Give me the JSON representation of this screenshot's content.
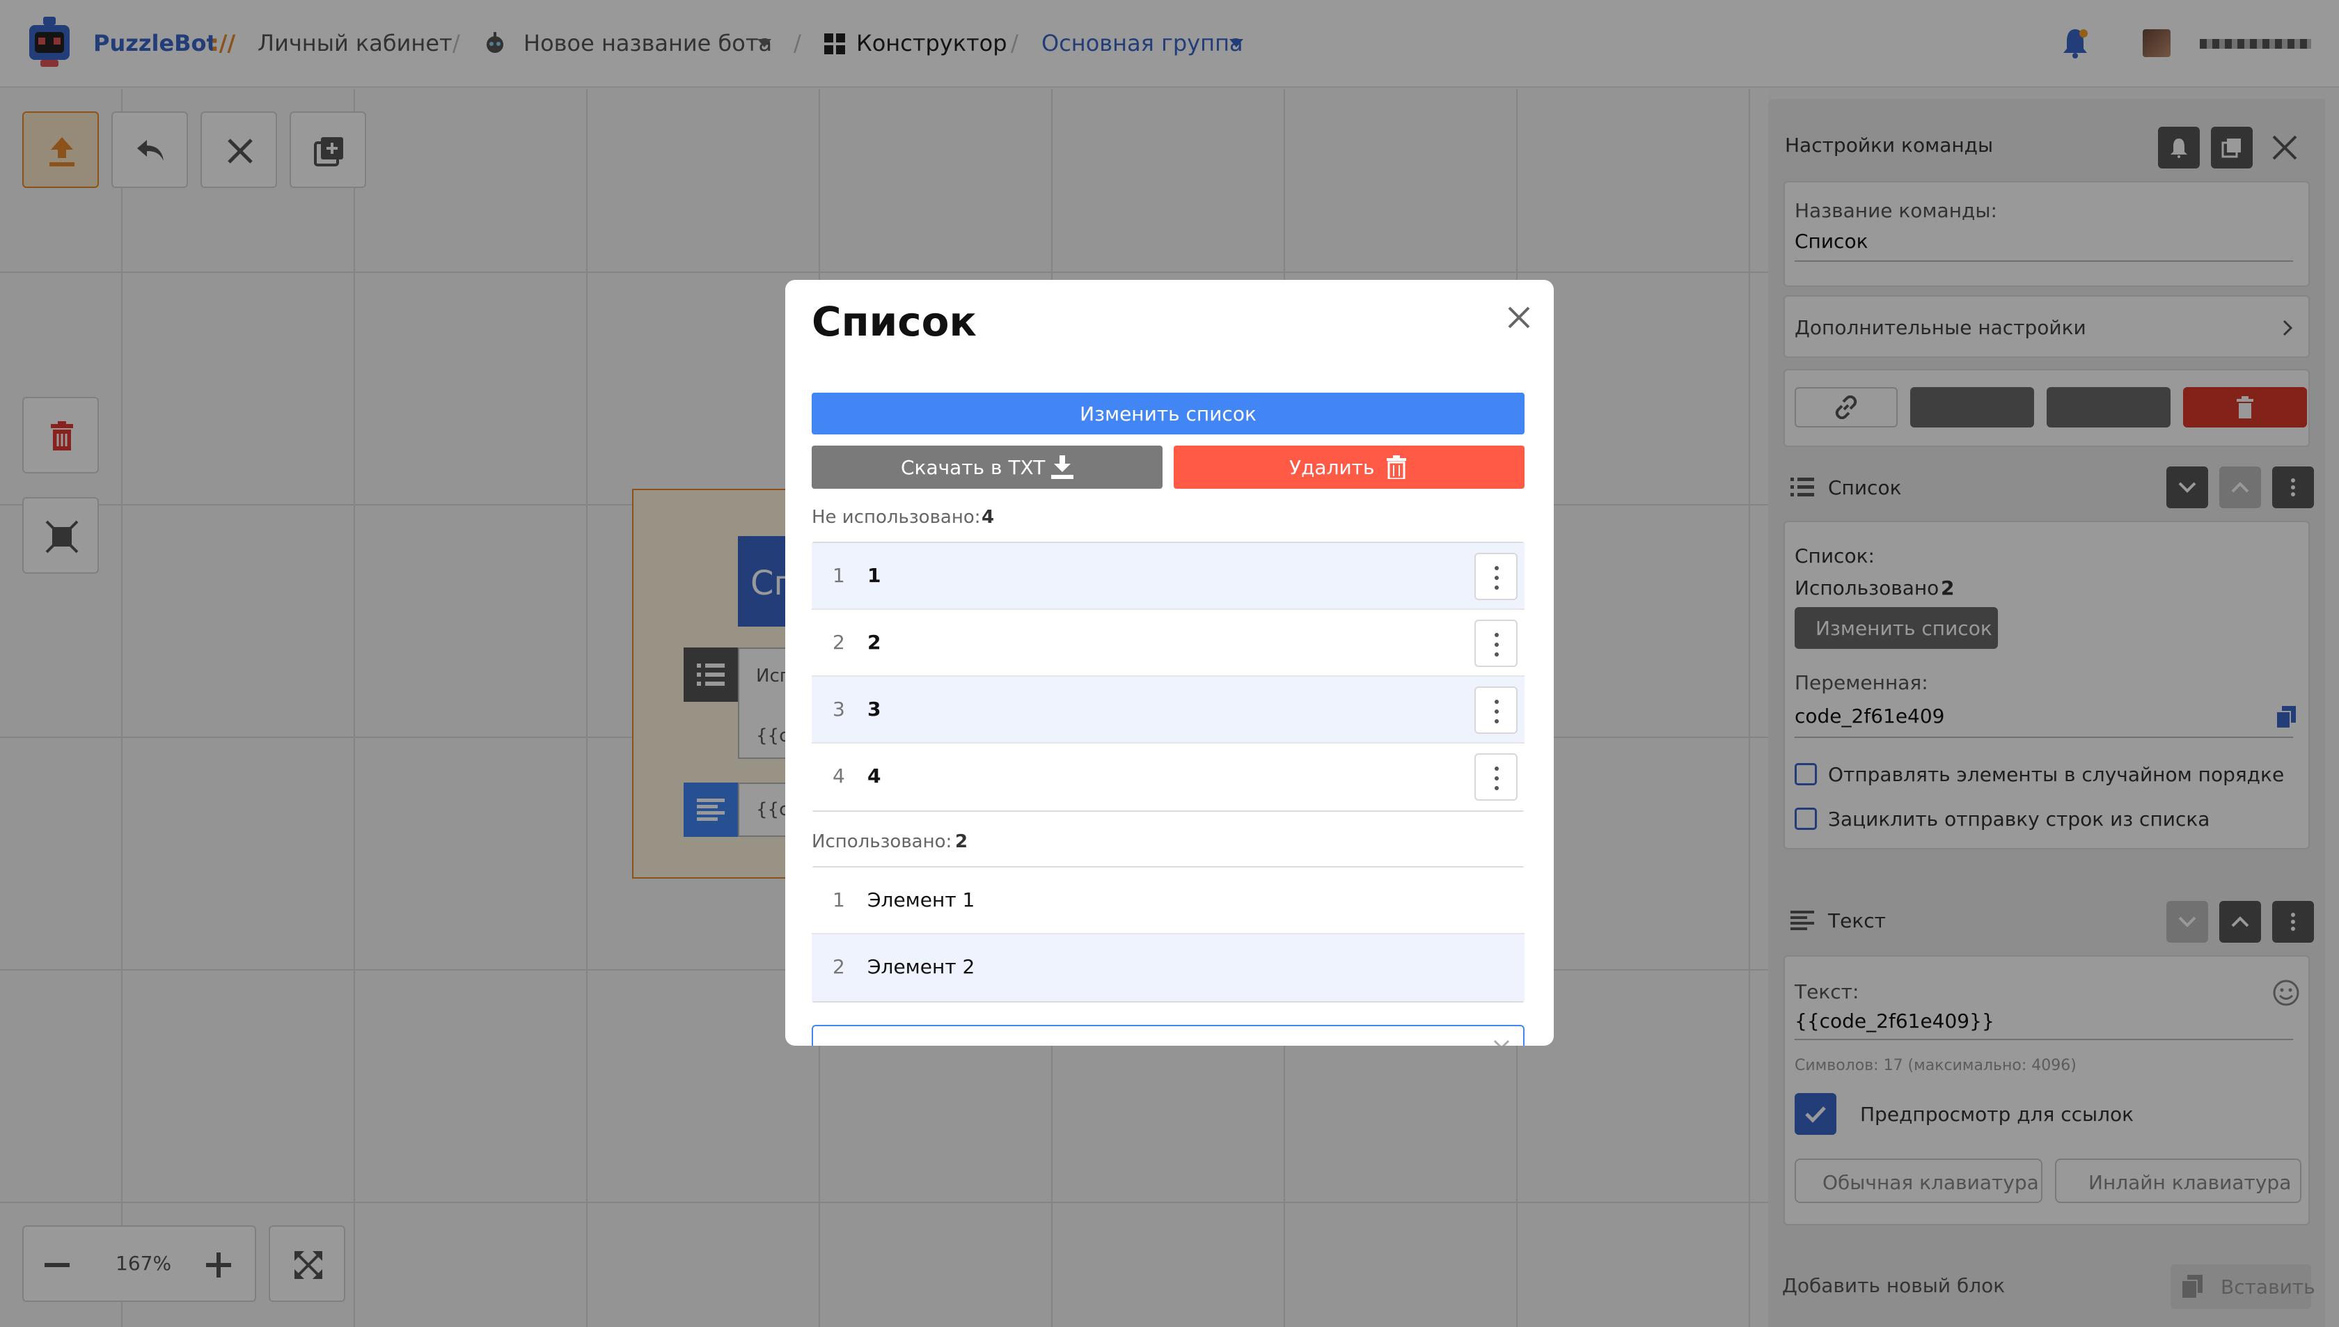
{
  "topbar": {
    "brand": "PuzzleBot",
    "brand_sep": "://",
    "cabinet": "Личный кабинет",
    "bot_name": "Новое название бота",
    "constructor": "Конструктор",
    "group": "Основная группа",
    "separator": "/"
  },
  "canvas": {
    "zoom": "167%",
    "node_title_partial": "Сп",
    "node_list_partial": "Исп",
    "node_var_partial_1": "{{co",
    "node_var_partial_2": "{{co"
  },
  "panel": {
    "title": "Настройки команды",
    "command_name_label": "Название команды:",
    "command_name_value": "Список",
    "extra_settings": "Дополнительные настройки",
    "list_block": {
      "title": "Список",
      "label": "Список:",
      "used_label": "Использовано",
      "used_count": "2",
      "edit_button": "Изменить список",
      "var_label": "Переменная:",
      "var_value": "code_2f61e409",
      "checkbox_random": "Отправлять элементы в случайном порядке",
      "checkbox_loop": "Зациклить отправку строк из списка"
    },
    "text_block": {
      "title": "Текст",
      "label": "Текст:",
      "value": "{{code_2f61e409}}",
      "counter": "Символов: 17 (максимально: 4096)",
      "preview_label": "Предпросмотр для ссылок",
      "kbd_regular": "Обычная клавиатура",
      "kbd_inline": "Инлайн клавиатура"
    },
    "add_block": "Добавить новый блок",
    "paste": "Вставить"
  },
  "modal": {
    "title": "Список",
    "edit_button": "Изменить список",
    "download_button": "Скачать в TXT",
    "delete_button": "Удалить",
    "unused_label": "Не использовано:",
    "unused_count": "4",
    "unused_items": [
      {
        "num": "1",
        "value": "1"
      },
      {
        "num": "2",
        "value": "2"
      },
      {
        "num": "3",
        "value": "3"
      },
      {
        "num": "4",
        "value": "4"
      }
    ],
    "used_label": "Использовано:",
    "used_count": "2",
    "used_items": [
      {
        "num": "1",
        "value": "Элемент 1"
      },
      {
        "num": "2",
        "value": "Элемент 2"
      }
    ]
  },
  "colors": {
    "primary": "#4285f4",
    "danger": "#ff5a45",
    "grey_button": "#7a7a7a",
    "brand": "#3a67c8",
    "row_alt": "#eef3fd"
  }
}
